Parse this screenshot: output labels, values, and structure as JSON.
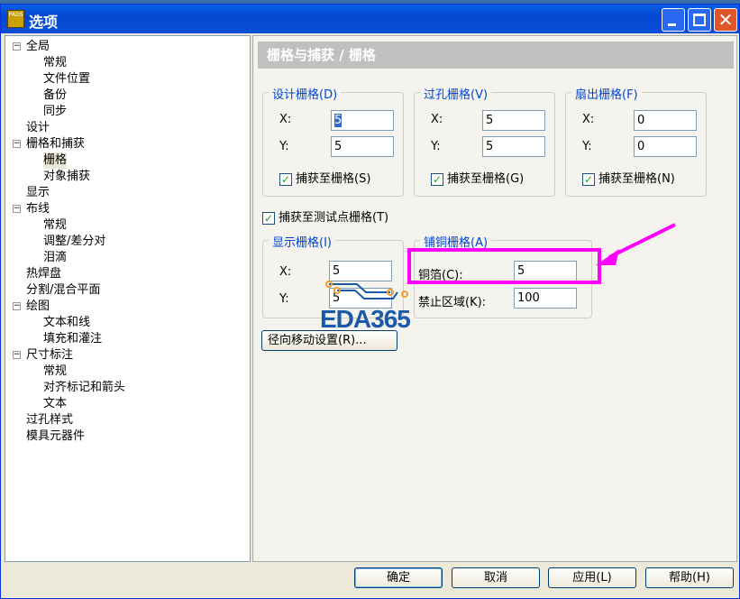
{
  "window": {
    "title": "选项",
    "app_icon_text": "PADS"
  },
  "tree": [
    {
      "label": "全局",
      "level": 0,
      "expander": "−"
    },
    {
      "label": "常规",
      "level": 1
    },
    {
      "label": "文件位置",
      "level": 1
    },
    {
      "label": "备份",
      "level": 1
    },
    {
      "label": "同步",
      "level": 1
    },
    {
      "label": "设计",
      "level": 0
    },
    {
      "label": "栅格和捕获",
      "level": 0,
      "expander": "−"
    },
    {
      "label": "栅格",
      "level": 1,
      "selected": true
    },
    {
      "label": "对象捕获",
      "level": 1
    },
    {
      "label": "显示",
      "level": 0
    },
    {
      "label": "布线",
      "level": 0,
      "expander": "−"
    },
    {
      "label": "常规",
      "level": 1
    },
    {
      "label": "调整/差分对",
      "level": 1
    },
    {
      "label": "泪滴",
      "level": 1
    },
    {
      "label": "热焊盘",
      "level": 0
    },
    {
      "label": "分割/混合平面",
      "level": 0
    },
    {
      "label": "绘图",
      "level": 0,
      "expander": "−"
    },
    {
      "label": "文本和线",
      "level": 1
    },
    {
      "label": "填充和灌注",
      "level": 1
    },
    {
      "label": "尺寸标注",
      "level": 0,
      "expander": "−"
    },
    {
      "label": "常规",
      "level": 1
    },
    {
      "label": "对齐标记和箭头",
      "level": 1
    },
    {
      "label": "文本",
      "level": 1
    },
    {
      "label": "过孔样式",
      "level": 0
    },
    {
      "label": "模具元器件",
      "level": 0
    }
  ],
  "panel": {
    "header": "栅格与捕获 / 栅格",
    "design_grid": {
      "legend": "设计栅格(D)",
      "x_label": "X:",
      "y_label": "Y:",
      "x": "5",
      "y": "5",
      "snap": "捕获至栅格(S)"
    },
    "via_grid": {
      "legend": "过孔栅格(V)",
      "x_label": "X:",
      "y_label": "Y:",
      "x": "5",
      "y": "5",
      "snap": "捕获至栅格(G)"
    },
    "fanout_grid": {
      "legend": "扇出栅格(F)",
      "x_label": "X:",
      "y_label": "Y:",
      "x": "0",
      "y": "0",
      "snap": "捕获至栅格(N)"
    },
    "snap_testpoint": "捕获至测试点栅格(T)",
    "display_grid": {
      "legend": "显示栅格(I)",
      "x_label": "X:",
      "y_label": "Y:",
      "x": "5",
      "y": "5"
    },
    "pour_grid": {
      "legend": "铺铜栅格(A)",
      "copper_label": "铜箔(C):",
      "copper": "5",
      "keepout_label": "禁止区域(K):",
      "keepout": "100"
    },
    "radial_button": "径向移动设置(R)...",
    "watermark": "EDA365"
  },
  "buttons": {
    "ok": "确定",
    "cancel": "取消",
    "apply": "应用(L)",
    "help": "帮助(H)"
  },
  "colors": {
    "highlight": "#ff00ff",
    "title_bar": "#0a5fe8"
  }
}
